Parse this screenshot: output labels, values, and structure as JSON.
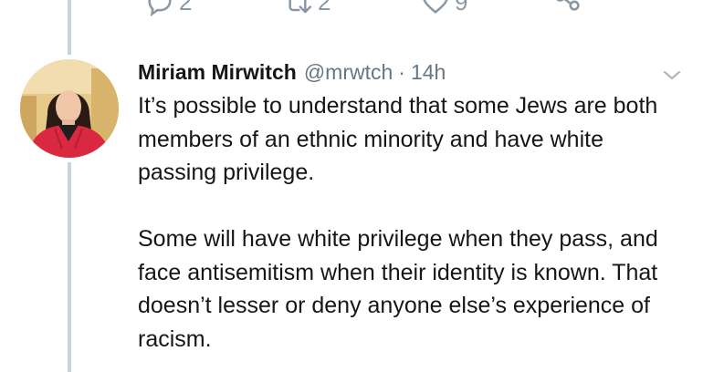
{
  "actions": {
    "reply_count": "2",
    "retweet_count": "2",
    "like_count": "9"
  },
  "tweet": {
    "author_name": "Miriam Mirwitch",
    "author_handle": "@mrwtch",
    "separator": "·",
    "timestamp": "14h",
    "paragraphs": [
      "It’s possible to understand that some Jews are both members of an ethnic minority and have white passing privilege.",
      "Some will have white privilege when they pass, and face antisemitism when their identity is known. That doesn’t lesser or deny anyone else’s experience of racism."
    ]
  },
  "icons": {
    "reply": "reply-icon",
    "retweet": "retweet-icon",
    "like": "heart-icon",
    "share": "share-icon",
    "caret": "chevron-down-icon"
  },
  "colors": {
    "icon_gray": "#8a98a6",
    "secondary_text": "#657786",
    "thread_line": "#c8d3dc",
    "avatar_jacket": "#d9283f"
  }
}
